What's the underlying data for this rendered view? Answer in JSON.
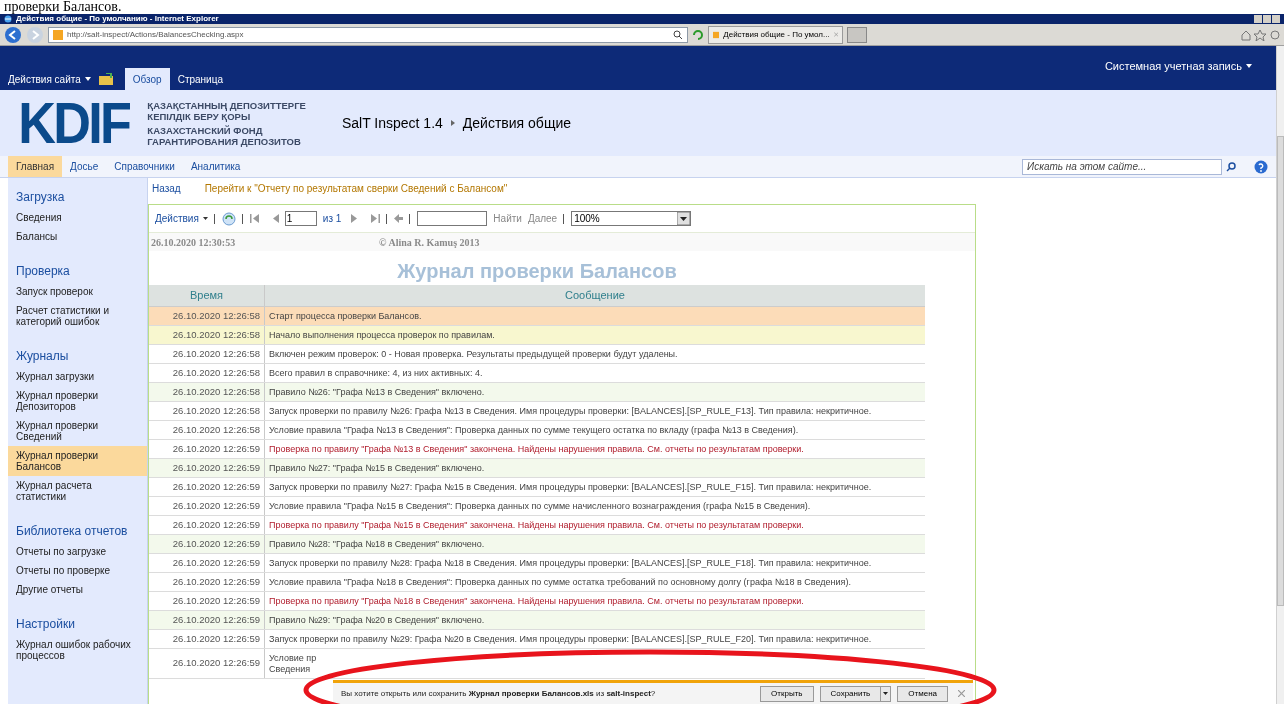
{
  "doc_caption": "проверки Балансов.",
  "browser": {
    "title": "Действия общие - По умолчанию - Internet Explorer",
    "address": "http://salt-inspect/Actions/BalancesChecking.aspx",
    "tab": "Действия общие - По умол..."
  },
  "ribbon": {
    "site_actions": "Действия сайта",
    "tabs": [
      {
        "label": "Обзор",
        "selected": true
      },
      {
        "label": "Страница",
        "selected": false
      }
    ],
    "user": "Системная учетная запись"
  },
  "header": {
    "logo": "KDIF",
    "org_lines": [
      "ҚАЗАҚСТАННЫҢ ДЕПОЗИТТЕРГЕ",
      "КЕПІЛДІК БЕРУ ҚОРЫ",
      "КАЗАХСТАНСКИЙ ФОНД",
      "ГАРАНТИРОВАНИЯ ДЕПОЗИТОВ"
    ],
    "breadcrumb": [
      "SalT Inspect 1.4",
      "Действия общие"
    ]
  },
  "nav": {
    "items": [
      {
        "label": "Главная",
        "selected": true
      },
      {
        "label": "Досье",
        "selected": false
      },
      {
        "label": "Справочники",
        "selected": false
      },
      {
        "label": "Аналитика",
        "selected": false
      }
    ],
    "search_placeholder": "Искать на этом сайте..."
  },
  "sidebar": {
    "groups": [
      {
        "heading": "Загрузка",
        "items": [
          {
            "label": "Сведения",
            "selected": false
          },
          {
            "label": "Балансы",
            "selected": false
          }
        ]
      },
      {
        "heading": "Проверка",
        "items": [
          {
            "label": "Запуск проверок",
            "selected": false
          },
          {
            "label": "Расчет статистики и категорий ошибок",
            "selected": false
          }
        ]
      },
      {
        "heading": "Журналы",
        "items": [
          {
            "label": "Журнал загрузки",
            "selected": false
          },
          {
            "label": "Журнал проверки Депозиторов",
            "selected": false
          },
          {
            "label": "Журнал проверки Сведений",
            "selected": false
          },
          {
            "label": "Журнал проверки Балансов",
            "selected": true
          },
          {
            "label": "Журнал расчета статистики",
            "selected": false
          }
        ]
      },
      {
        "heading": "Библиотека отчетов",
        "items": [
          {
            "label": "Отчеты по загрузке",
            "selected": false
          },
          {
            "label": "Отчеты по проверке",
            "selected": false
          },
          {
            "label": "Другие отчеты",
            "selected": false
          }
        ]
      },
      {
        "heading": "Настройки",
        "items": [
          {
            "label": "Журнал ошибок рабочих процессов",
            "selected": false
          }
        ]
      }
    ]
  },
  "links": {
    "back": "Назад",
    "goto": "Перейти к \"Отчету по результатам сверки Сведений с Балансом\""
  },
  "report_toolbar": {
    "actions": "Действия",
    "page": "1",
    "of": "из 1",
    "find": "Найти",
    "next": "Далее",
    "zoom": "100%"
  },
  "report": {
    "date": "26.10.2020 12:30:53",
    "copyright": "© Alina R. Kamuş 2013",
    "title": "Журнал проверки Балансов",
    "columns": [
      "Время",
      "Сообщение"
    ],
    "rows": [
      {
        "time": "26.10.2020 12:26:58",
        "message": "Старт процесса проверки Балансов.",
        "kind": "start"
      },
      {
        "time": "26.10.2020 12:26:58",
        "message": "Начало выполнения процесса проверок по правилам.",
        "kind": "stage"
      },
      {
        "time": "26.10.2020 12:26:58",
        "message": "Включен режим проверок: 0 - Новая проверка. Результаты предыдущей проверки будут удалены.",
        "kind": "info"
      },
      {
        "time": "26.10.2020 12:26:58",
        "message": "Всего правил в справочнике: 4, из них активных: 4.",
        "kind": "info"
      },
      {
        "time": "26.10.2020 12:26:58",
        "message": "Правило №26: \"Графа №13 в Сведения\" включено.",
        "kind": "rule"
      },
      {
        "time": "26.10.2020 12:26:58",
        "message": "Запуск проверки по правилу №26: Графа №13 в Сведения. Имя процедуры проверки: [BALANCES].[SP_RULE_F13]. Тип правила: некритичное.",
        "kind": "info"
      },
      {
        "time": "26.10.2020 12:26:58",
        "message": "Условие правила \"Графа №13 в Сведения\": Проверка данных по сумме текущего остатка по вкладу (графа №13 в Сведения).",
        "kind": "info"
      },
      {
        "time": "26.10.2020 12:26:59",
        "message": "Проверка по правилу \"Графа №13 в Сведения\" закончена. Найдены нарушения правила. См. отчеты по результатам проверки.",
        "kind": "error"
      },
      {
        "time": "26.10.2020 12:26:59",
        "message": "Правило №27: \"Графа №15 в Сведения\" включено.",
        "kind": "rule"
      },
      {
        "time": "26.10.2020 12:26:59",
        "message": "Запуск проверки по правилу №27: Графа №15 в Сведения. Имя процедуры проверки: [BALANCES].[SP_RULE_F15]. Тип правила: некритичное.",
        "kind": "info"
      },
      {
        "time": "26.10.2020 12:26:59",
        "message": "Условие правила \"Графа №15 в Сведения\": Проверка данных по сумме начисленного вознаграждения (графа №15 в Сведения).",
        "kind": "info"
      },
      {
        "time": "26.10.2020 12:26:59",
        "message": "Проверка по правилу \"Графа №15 в Сведения\" закончена. Найдены нарушения правила. См. отчеты по результатам проверки.",
        "kind": "error"
      },
      {
        "time": "26.10.2020 12:26:59",
        "message": "Правило №28: \"Графа №18 в Сведения\" включено.",
        "kind": "rule"
      },
      {
        "time": "26.10.2020 12:26:59",
        "message": "Запуск проверки по правилу №28: Графа №18 в Сведения. Имя процедуры проверки: [BALANCES].[SP_RULE_F18]. Тип правила: некритичное.",
        "kind": "info"
      },
      {
        "time": "26.10.2020 12:26:59",
        "message": "Условие правила \"Графа №18 в Сведения\": Проверка данных по сумме остатка требований по основному долгу (графа №18 в Сведения).",
        "kind": "info"
      },
      {
        "time": "26.10.2020 12:26:59",
        "message": "Проверка по правилу \"Графа №18 в Сведения\" закончена. Найдены нарушения правила. См. отчеты по результатам проверки.",
        "kind": "error"
      },
      {
        "time": "26.10.2020 12:26:59",
        "message": "Правило №29: \"Графа №20 в Сведения\" включено.",
        "kind": "rule"
      },
      {
        "time": "26.10.2020 12:26:59",
        "message": "Запуск проверки по правилу №29: Графа №20 в Сведения. Имя процедуры проверки: [BALANCES].[SP_RULE_F20]. Тип правила: некритичное.",
        "kind": "info"
      },
      {
        "time": "26.10.2020 12:26:59",
        "message": "Условие пр\nСведения",
        "kind": "info"
      }
    ]
  },
  "download_bar": {
    "text": "Вы хотите открыть или сохранить **Журнал проверки Балансов.xls** из **salt-inspect**?",
    "buttons": [
      "Открыть",
      "Сохранить",
      "Отмена"
    ]
  }
}
